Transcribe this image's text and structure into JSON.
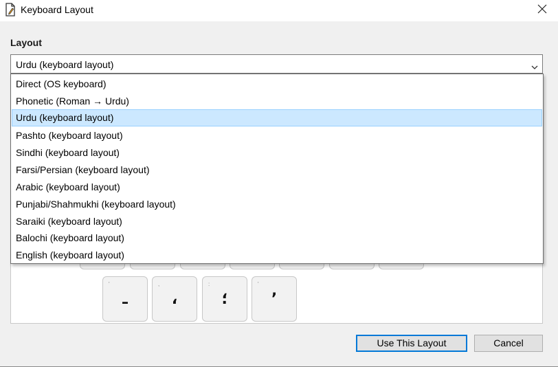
{
  "window": {
    "title": "Keyboard Layout",
    "app_icon": "document-pen-icon",
    "close_icon": "close-icon"
  },
  "layout": {
    "label": "Layout",
    "selected_value": "Urdu (keyboard layout)",
    "options": [
      "Direct (OS keyboard)",
      "Phonetic (Roman → Urdu)",
      "Urdu (keyboard layout)",
      "Pashto (keyboard layout)",
      "Sindhi (keyboard layout)",
      "Farsi/Persian (keyboard layout)",
      "Arabic (keyboard layout)",
      "Punjabi/Shahmukhi (keyboard layout)",
      "Saraiki (keyboard layout)",
      "Balochi (keyboard layout)",
      "English (keyboard layout)"
    ],
    "selected_index": 2
  },
  "keyboard_preview": {
    "keys": [
      {
        "hint": "'",
        "glyph": "ـ"
      },
      {
        "hint": ",",
        "glyph": "،"
      },
      {
        "hint": ":",
        "glyph": "؛"
      },
      {
        "hint": "'",
        "glyph": "ʼ"
      }
    ]
  },
  "buttons": {
    "use_layout": "Use This Layout",
    "cancel": "Cancel"
  },
  "colors": {
    "selection_bg": "#cce8ff",
    "selection_border": "#99d1ff",
    "default_button_border": "#0078d7"
  }
}
